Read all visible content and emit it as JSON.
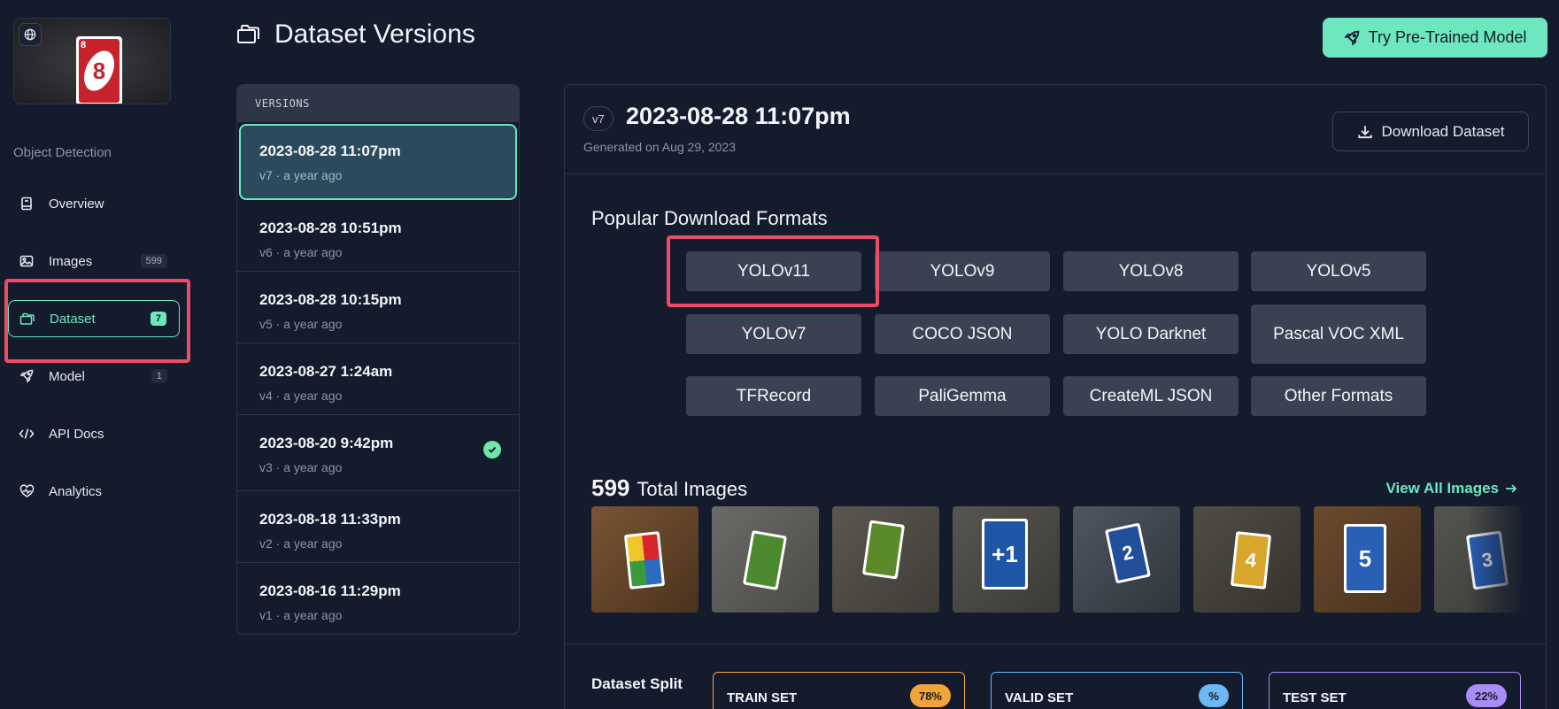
{
  "sidebar": {
    "project_type": "Object Detection",
    "items": [
      {
        "label": "Overview",
        "icon": "book-icon",
        "badge": ""
      },
      {
        "label": "Images",
        "icon": "image-icon",
        "badge": "599"
      },
      {
        "label": "Dataset",
        "icon": "folders-icon",
        "badge": "7"
      },
      {
        "label": "Model",
        "icon": "rocket-icon",
        "badge": "1"
      },
      {
        "label": "API Docs",
        "icon": "code-icon",
        "badge": ""
      },
      {
        "label": "Analytics",
        "icon": "heart-pulse-icon",
        "badge": ""
      }
    ],
    "thumbnail_card_number": "8"
  },
  "header": {
    "title": "Dataset Versions",
    "try_button": "Try Pre-Trained Model"
  },
  "versions": {
    "heading": "VERSIONS",
    "items": [
      {
        "date": "2023-08-28 11:07pm",
        "meta": "v7 · a year ago"
      },
      {
        "date": "2023-08-28 10:51pm",
        "meta": "v6 · a year ago"
      },
      {
        "date": "2023-08-28 10:15pm",
        "meta": "v5 · a year ago"
      },
      {
        "date": "2023-08-27 1:24am",
        "meta": "v4 · a year ago"
      },
      {
        "date": "2023-08-20 9:42pm",
        "meta": "v3 · a year ago"
      },
      {
        "date": "2023-08-18 11:33pm",
        "meta": "v2 · a year ago"
      },
      {
        "date": "2023-08-16 11:29pm",
        "meta": "v1 · a year ago"
      }
    ]
  },
  "main": {
    "version_badge": "v7",
    "version_title": "2023-08-28 11:07pm",
    "generated": "Generated on Aug 29, 2023",
    "download_button": "Download Dataset",
    "formats_title": "Popular Download Formats",
    "formats": [
      "YOLOv11",
      "YOLOv9",
      "YOLOv8",
      "YOLOv5",
      "YOLOv7",
      "COCO JSON",
      "YOLO Darknet",
      "Pascal VOC XML",
      "TFRecord",
      "PaliGemma",
      "CreateML JSON",
      "Other Formats"
    ],
    "total_count": "599",
    "total_label": "Total Images",
    "view_all": "View All Images",
    "gallery_cards": [
      "",
      "",
      "",
      "+1",
      "2",
      "4",
      "5",
      "3"
    ],
    "split_title": "Dataset Split",
    "splits": [
      {
        "label": "TRAIN SET",
        "pct": "78%",
        "color": "#f0a43a"
      },
      {
        "label": "VALID SET",
        "pct": "%",
        "color": "#6cb7f5"
      },
      {
        "label": "TEST SET",
        "pct": "22%",
        "color": "#a98cf5"
      }
    ]
  },
  "colors": {
    "accent": "#6ee7c0",
    "background": "#141b2d",
    "highlight": "#ea4d66"
  }
}
